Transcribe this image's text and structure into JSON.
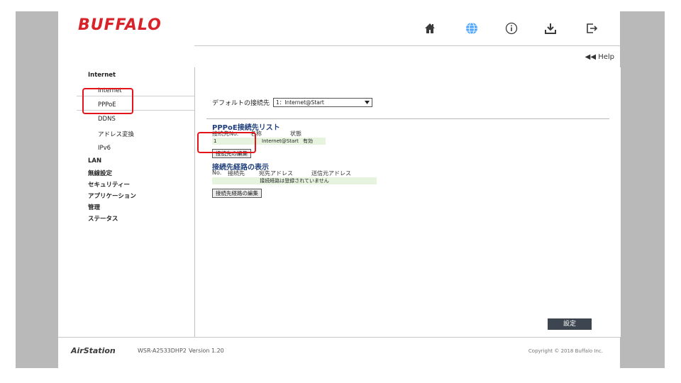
{
  "header": {
    "logo": "BUFFALO",
    "icons": [
      "home-icon",
      "globe-icon",
      "info-icon",
      "download-icon",
      "logout-icon"
    ]
  },
  "help": {
    "label": "◀◀ Help"
  },
  "sidebar": {
    "items": [
      {
        "label": "Internet",
        "level": "top"
      },
      {
        "label": "Internet",
        "level": "sub"
      },
      {
        "label": "PPPoE",
        "level": "sub",
        "selected": true
      },
      {
        "label": "DDNS",
        "level": "sub"
      },
      {
        "label": "アドレス変換",
        "level": "sub"
      },
      {
        "label": "IPv6",
        "level": "sub"
      },
      {
        "label": "LAN",
        "level": "top"
      },
      {
        "label": "無線設定",
        "level": "top"
      },
      {
        "label": "セキュリティー",
        "level": "top"
      },
      {
        "label": "アプリケーション",
        "level": "top"
      },
      {
        "label": "管理",
        "level": "top"
      },
      {
        "label": "ステータス",
        "level": "top"
      }
    ]
  },
  "content": {
    "default_label": "デフォルトの接続先",
    "default_value": "1：Internet@Start",
    "pppoe_heading": "PPPoE接続先リスト",
    "pppoe_cols": {
      "no": "接続先No.",
      "name": "名称",
      "status": "状態"
    },
    "pppoe_row": {
      "no": "1",
      "name": "Internet@Start",
      "status": "有効"
    },
    "edit_connection_button": "接続先の編集",
    "route_heading": "接続先経路の表示",
    "route_cols": {
      "no": "No.",
      "dest": "接続先",
      "to": "宛先アドレス",
      "from": "送信元アドレス"
    },
    "route_empty": "接続経路は登録されていません",
    "edit_route_button": "接続先経路の編集",
    "set_button": "設定"
  },
  "footer": {
    "product": "AirStation",
    "model": "WSR-A2533DHP2",
    "version": "Version 1.20",
    "copyright": "Copyright © 2018 Buffalo Inc."
  },
  "colors": {
    "logo": "#d8232a",
    "heading": "#1f3f7a",
    "active_icon": "#4aa3ff",
    "highlight": "#e4141b",
    "row_bg": "#e6f4df"
  }
}
